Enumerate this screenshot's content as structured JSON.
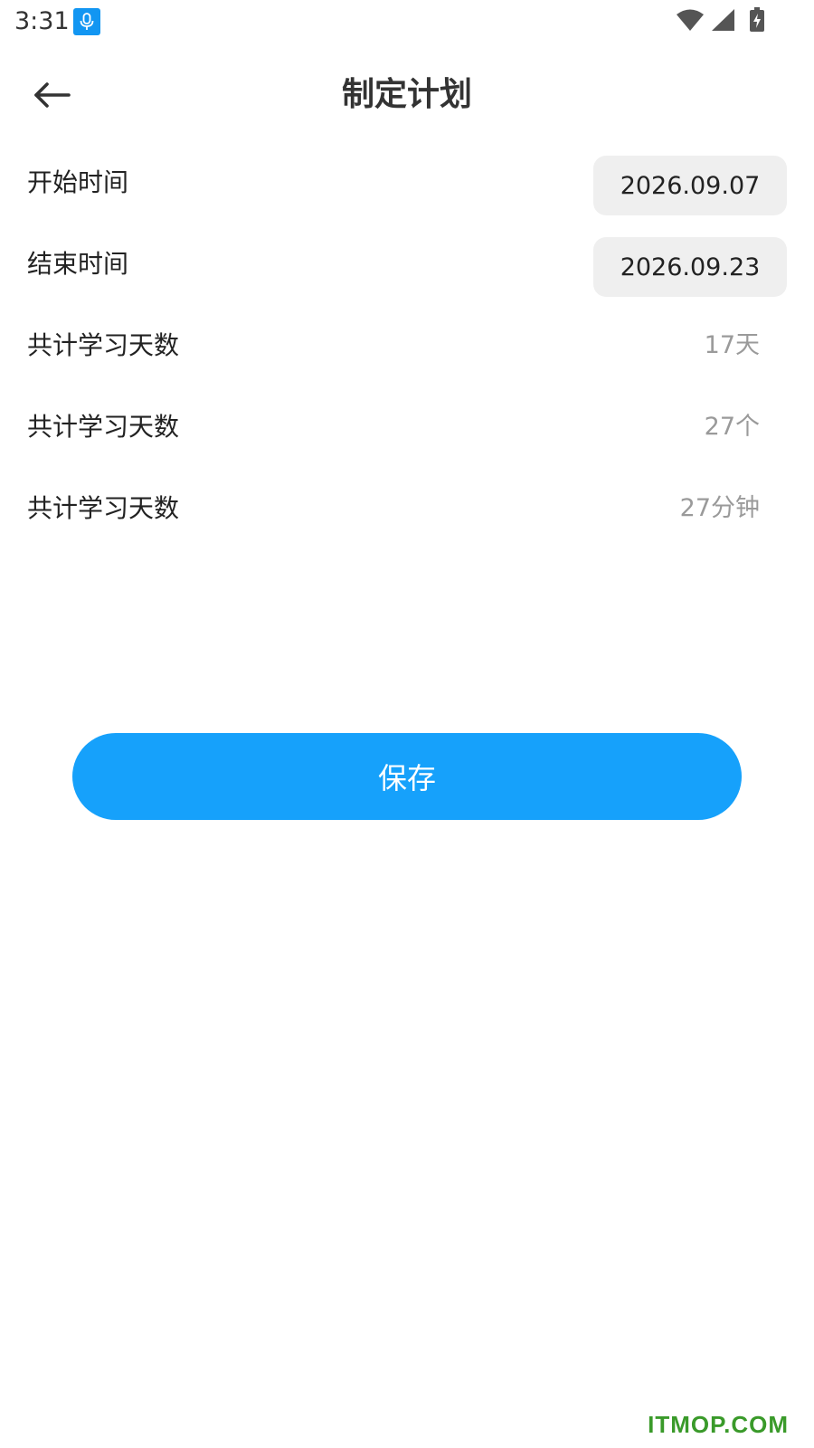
{
  "status_bar": {
    "time": "3:31",
    "icons": [
      "microphone-icon",
      "wifi-icon",
      "cell-signal-icon",
      "battery-charging-icon"
    ]
  },
  "app_bar": {
    "title": "制定计划",
    "back_icon": "arrow-left-icon"
  },
  "form": {
    "rows": [
      {
        "label": "开始时间",
        "value": "2026.09.07",
        "kind": "date"
      },
      {
        "label": "结束时间",
        "value": "2026.09.23",
        "kind": "date"
      },
      {
        "label": "共计学习天数",
        "value": "17天",
        "kind": "text"
      },
      {
        "label": "共计学习天数",
        "value": "27个",
        "kind": "text"
      },
      {
        "label": "共计学习天数",
        "value": "27分钟",
        "kind": "text"
      }
    ]
  },
  "actions": {
    "save_label": "保存"
  },
  "watermark": {
    "text": "ITMOP.COM"
  },
  "colors": {
    "primary": "#16a1fb",
    "pill_bg": "#efefef",
    "muted_text": "#9a9a9a",
    "watermark": "#3a9a2a"
  }
}
